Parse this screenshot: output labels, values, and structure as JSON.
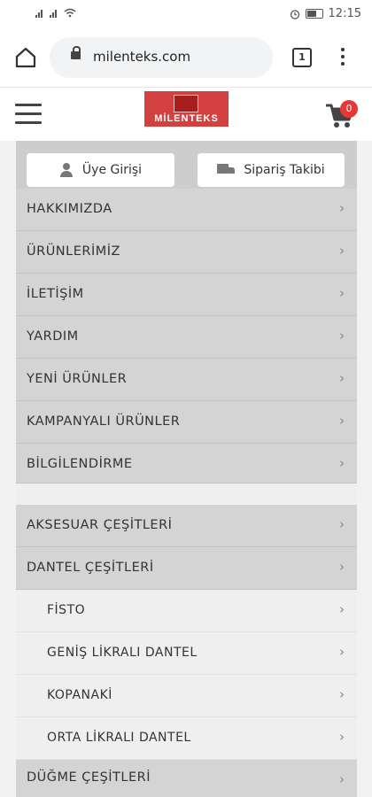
{
  "status_bar": {
    "time": "12:15"
  },
  "browser": {
    "url": "milenteks.com",
    "tab_count": "1"
  },
  "header": {
    "logo_text": "MİLENTEKS",
    "cart_count": "0"
  },
  "top_buttons": {
    "login_label": "Üye Girişi",
    "order_track_label": "Sipariş Takibi"
  },
  "menu": {
    "items": [
      {
        "label": "HAKKIMIZDA"
      },
      {
        "label": "ÜRÜNLERİMİZ"
      },
      {
        "label": "İLETİŞİM"
      },
      {
        "label": "YARDIM"
      },
      {
        "label": "YENİ ÜRÜNLER"
      },
      {
        "label": "KAMPANYALI ÜRÜNLER"
      },
      {
        "label": "BİLGİLENDİRME"
      }
    ],
    "categories": [
      {
        "label": "AKSESUAR ÇEŞİTLERİ"
      },
      {
        "label": "DANTEL ÇEŞİTLERİ"
      }
    ],
    "subitems": [
      {
        "label": "FİSTO"
      },
      {
        "label": "GENİŞ LİKRALI DANTEL"
      },
      {
        "label": "KOPANAKİ"
      },
      {
        "label": "ORTA LİKRALI DANTEL"
      }
    ],
    "last_category": {
      "label": "DÜĞME ÇEŞİTLERİ"
    },
    "chevron": "›"
  },
  "colors": {
    "accent": "#e53935",
    "menu_bg": "#d4d4d4",
    "submenu_bg": "#efefef"
  }
}
